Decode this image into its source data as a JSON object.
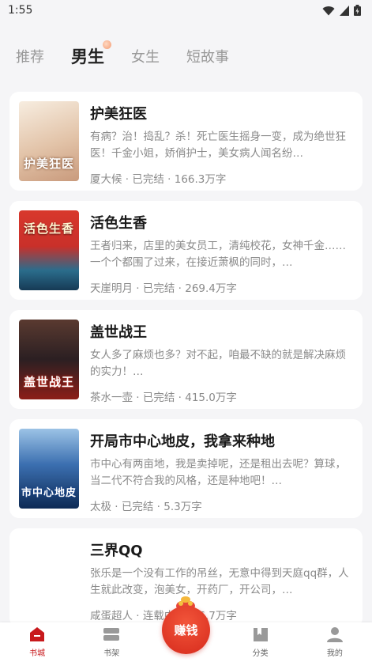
{
  "status": {
    "time": "1:55"
  },
  "tabs": [
    {
      "label": "推荐",
      "active": false
    },
    {
      "label": "男生",
      "active": true
    },
    {
      "label": "女生",
      "active": false
    },
    {
      "label": "短故事",
      "active": false
    }
  ],
  "books": [
    {
      "title": "护美狂医",
      "desc": "有病？治！捣乱？杀！死亡医生摇身一变，成为绝世狂医！千金小姐，娇俏护士，美女病人闻名纷…",
      "meta": "厦大候 · 已完结 · 166.3万字",
      "cover_text": "护美狂医",
      "cover_colors": [
        "#f3e6d6",
        "#d9b8a0"
      ]
    },
    {
      "title": "活色生香",
      "desc": "王者归来，店里的美女员工，清纯校花，女神千金……一个个都围了过来，在接近萧枫的同时，…",
      "meta": "天崖明月 · 已完结 · 269.4万字",
      "cover_text": "活色生香",
      "cover_colors": [
        "#d6342a",
        "#1f5a7a"
      ]
    },
    {
      "title": "盖世战王",
      "desc": "女人多了麻烦也多？对不起，咱最不缺的就是解决麻烦的实力！…",
      "meta": "茶水一壶 · 已完结 · 415.0万字",
      "cover_text": "盖世战王",
      "cover_colors": [
        "#3a2a2a",
        "#b3261e"
      ]
    },
    {
      "title": "开局市中心地皮，我拿来种地",
      "desc": "市中心有两亩地，我是卖掉呢，还是租出去呢？算球，当二代不符合我的风格，还是种地吧！…",
      "meta": "太极 · 已完结 · 5.3万字",
      "cover_text": "市中心地皮",
      "cover_colors": [
        "#3b6fb0",
        "#0d2a55"
      ]
    },
    {
      "title": "三界QQ",
      "desc": "张乐是一个没有工作的吊丝，无意中得到天庭qq群，人生就此改变，泡美女，开药厂，开公司，…",
      "meta": "咸蛋超人 · 连载中 · 196.7万字",
      "cover_text": "",
      "cover_colors": [
        "#ffffff",
        "#ffffff"
      ]
    }
  ],
  "nav": {
    "items": [
      {
        "label": "书城",
        "icon": "home-icon",
        "active": true
      },
      {
        "label": "书架",
        "icon": "bookshelf-icon",
        "active": false
      },
      {
        "label": "分类",
        "icon": "category-icon",
        "active": false
      },
      {
        "label": "我的",
        "icon": "profile-icon",
        "active": false
      }
    ],
    "earn_label": "赚钱"
  },
  "colors": {
    "accent": "#c8191c",
    "background": "#f5f5f7"
  }
}
